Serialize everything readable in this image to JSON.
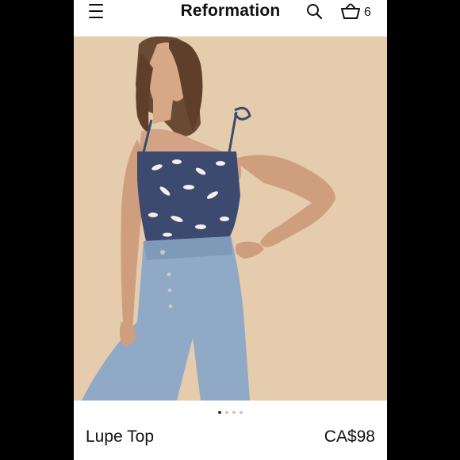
{
  "header": {
    "brand": "Reformation",
    "cart_count": "6"
  },
  "icons": {
    "menu": "hamburger-menu-icon",
    "search": "search-icon",
    "cart": "basket-icon"
  },
  "carousel": {
    "total": 4,
    "active_index": 0
  },
  "product": {
    "name": "Lupe Top",
    "price": "CA$98"
  },
  "colors": {
    "background": "#000000",
    "panel": "#ffffff",
    "photo_backdrop": "#e4ccad",
    "text": "#111111"
  }
}
